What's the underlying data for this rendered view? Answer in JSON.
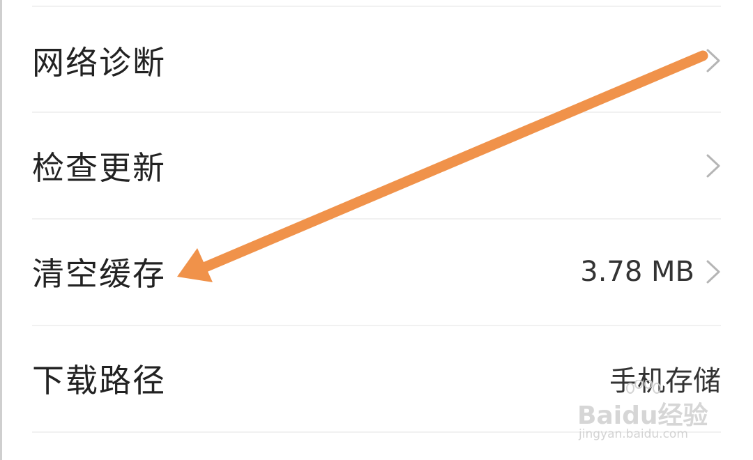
{
  "settings": {
    "rows": [
      {
        "label": "网络诊断",
        "value": "",
        "has_chevron": true
      },
      {
        "label": "检查更新",
        "value": "",
        "has_chevron": true
      },
      {
        "label": "清空缓存",
        "value": "3.78 MB",
        "has_chevron": true
      },
      {
        "label": "下载路径",
        "value": "手机存储",
        "has_chevron": false
      }
    ]
  },
  "annotation": {
    "arrow_color": "#F0924A"
  },
  "watermark": {
    "logo_text": "Baidu经验",
    "url": "jingyan.baidu.com"
  },
  "colors": {
    "label_text": "#222222",
    "value_text": "#333333",
    "chevron": "#b5b5b5",
    "divider": "#f1f1f1"
  },
  "icons": [
    "chevron-right-icon"
  ]
}
